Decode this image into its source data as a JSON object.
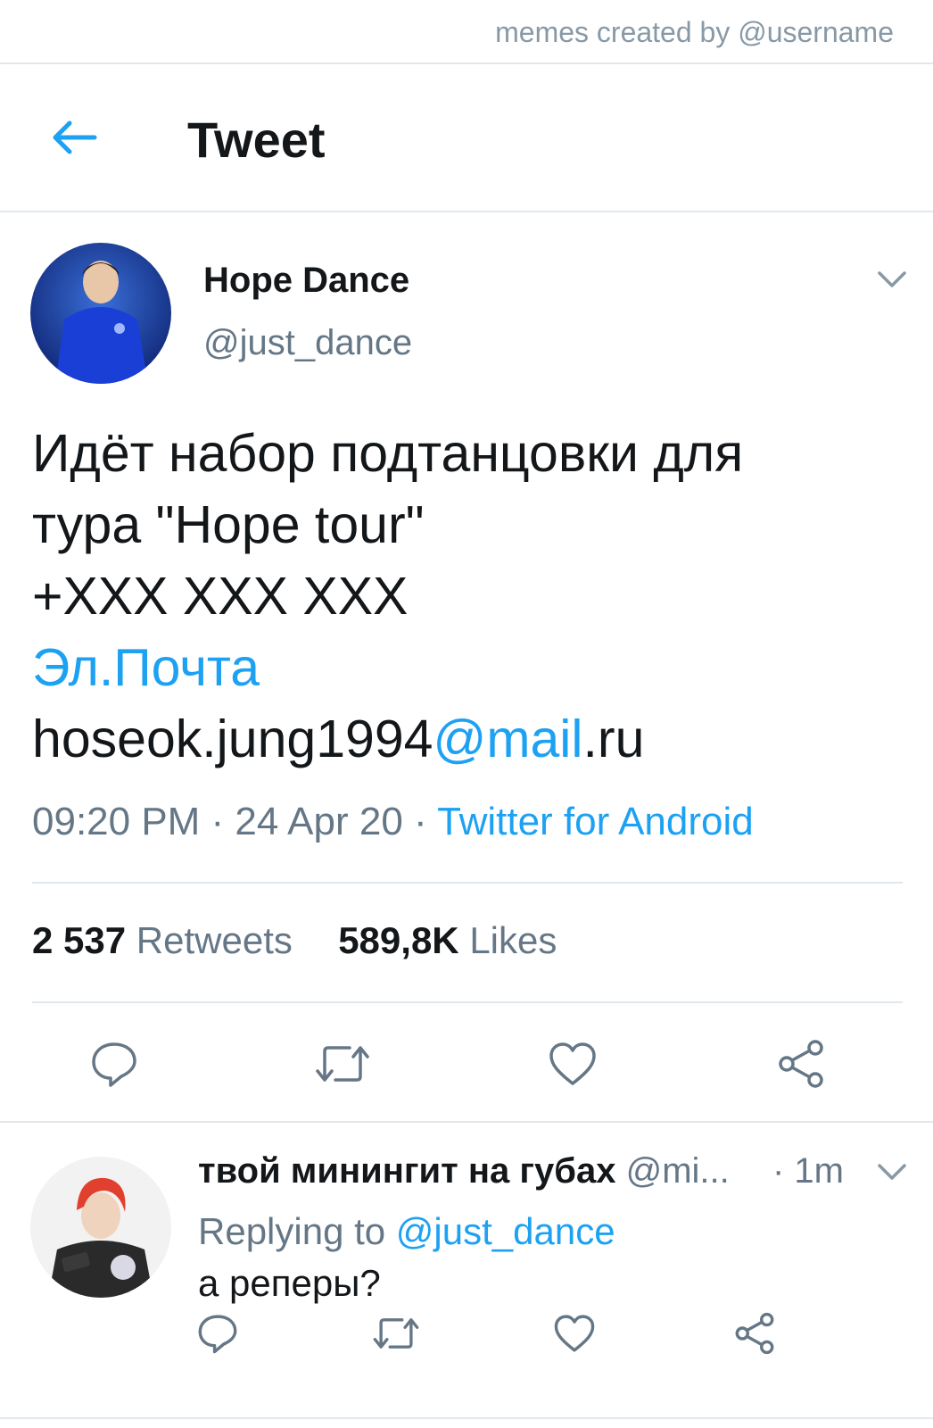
{
  "watermark": "memes created by @username",
  "header": {
    "title": "Tweet",
    "back_icon": "arrow-left-icon"
  },
  "tweet": {
    "author_name": "Hope Dance",
    "author_handle": "@just_dance",
    "text_line1": "Идёт набор подтанцовки для",
    "text_line2": "тура \"Hope tour\"",
    "text_line3": "+XXX XXX XXX",
    "text_line4": "Эл.Почта",
    "email_user": "hoseok.jung1994",
    "email_domain": "@mail",
    "email_tld": ".ru",
    "timestamp": "09:20 PM · 24 Apr 20 · ",
    "source": "Twitter for Android",
    "retweets_count": "2 537",
    "retweets_label": "Retweets",
    "likes_count": "589,8K",
    "likes_label": "Likes"
  },
  "reply": {
    "name": "твой минингит на губах",
    "handle": "@mi...",
    "time": "· 1m",
    "replying_prefix": "Replying to ",
    "replying_to": "@just_dance",
    "text": "а реперы?"
  },
  "colors": {
    "accent": "#1da1f2",
    "muted": "#657786",
    "text": "#14171a",
    "border": "#e1e8ed"
  },
  "icons": [
    "arrow-left-icon",
    "chevron-down-icon",
    "reply-icon",
    "retweet-icon",
    "like-icon",
    "share-icon"
  ]
}
